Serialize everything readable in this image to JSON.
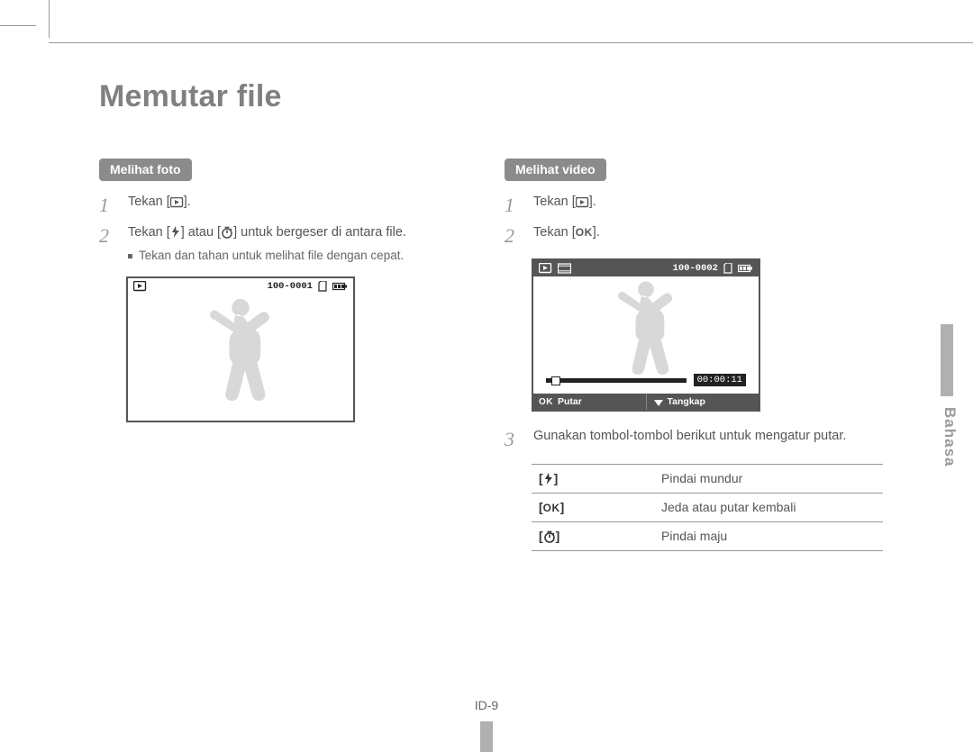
{
  "title": "Memutar file",
  "side_label": "Bahasa",
  "page_number": "ID-9",
  "left": {
    "heading": "Melihat foto",
    "steps": [
      {
        "pre": "Tekan [",
        "icon": "play-box",
        "post": "]."
      },
      {
        "pre": "Tekan [",
        "icon": "flash",
        "mid": "] atau [",
        "icon2": "timer",
        "post": "] untuk bergeser di antara file."
      }
    ],
    "note": "Tekan dan tahan untuk melihat file dengan cepat.",
    "lcd": {
      "counter": "100-0001"
    }
  },
  "right": {
    "heading": "Melihat video",
    "steps": [
      {
        "pre": "Tekan [",
        "icon": "play-box",
        "post": "]."
      },
      {
        "pre": "Tekan [",
        "icon": "ok",
        "post": "]."
      }
    ],
    "lcd": {
      "counter": "100-0002",
      "time": "00:00:11",
      "footer_play_key": "OK",
      "footer_play_label": "Putar",
      "footer_capture_label": "Tangkap"
    },
    "step3": "Gunakan tombol-tombol berikut untuk mengatur putar.",
    "controls": [
      {
        "key_icon": "flash",
        "desc": "Pindai mundur"
      },
      {
        "key_icon": "ok",
        "desc": "Jeda atau putar kembali"
      },
      {
        "key_icon": "timer",
        "desc": "Pindai maju"
      }
    ]
  }
}
